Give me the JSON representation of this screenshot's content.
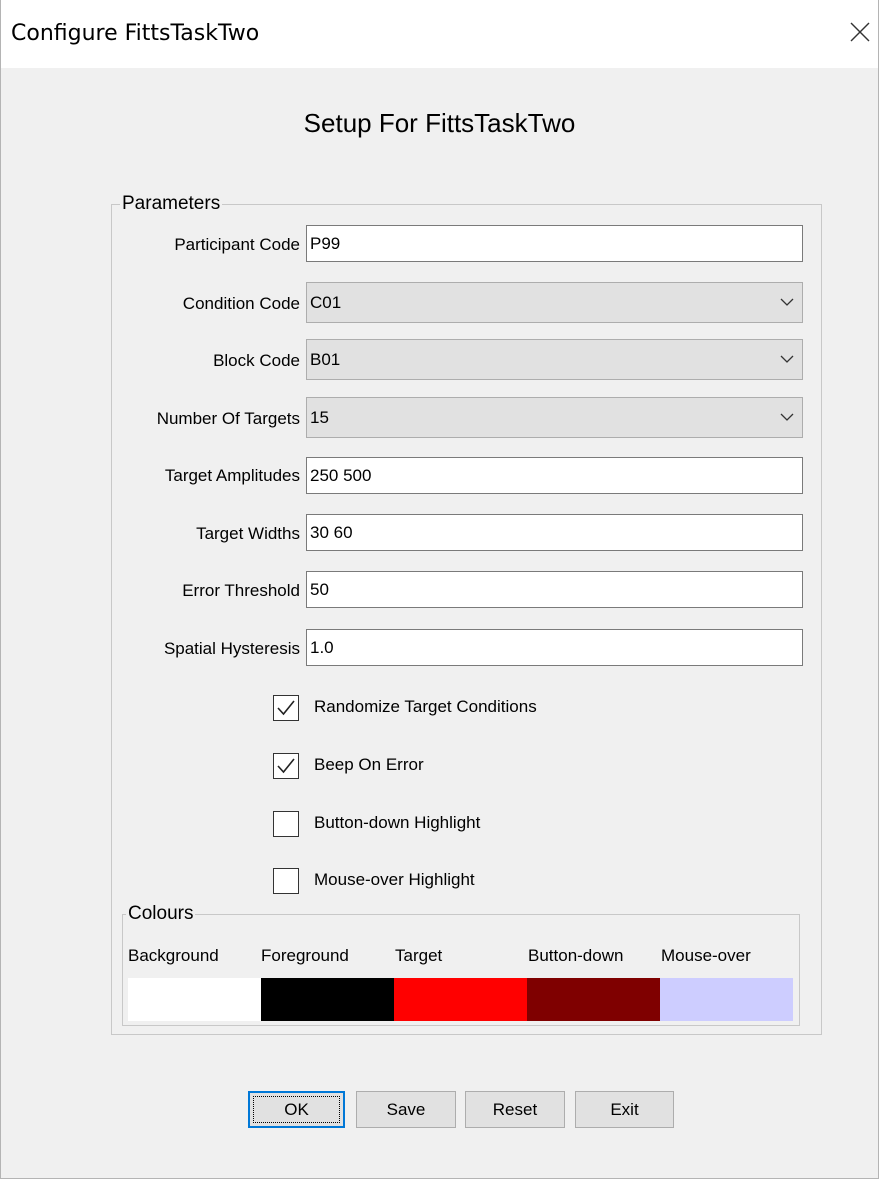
{
  "window": {
    "title": "Configure FittsTaskTwo"
  },
  "heading": "Setup For FittsTaskTwo",
  "parameters": {
    "legend": "Parameters",
    "participant_code": {
      "label": "Participant Code",
      "value": "P99"
    },
    "condition_code": {
      "label": "Condition Code",
      "value": "C01"
    },
    "block_code": {
      "label": "Block Code",
      "value": "B01"
    },
    "number_of_targets": {
      "label": "Number Of Targets",
      "value": "15"
    },
    "target_amplitudes": {
      "label": "Target Amplitudes",
      "value": "250 500"
    },
    "target_widths": {
      "label": "Target Widths",
      "value": "30 60"
    },
    "error_threshold": {
      "label": "Error Threshold",
      "value": "50"
    },
    "spatial_hysteresis": {
      "label": "Spatial Hysteresis",
      "value": "1.0"
    },
    "checkboxes": [
      {
        "label": "Randomize Target Conditions",
        "checked": true
      },
      {
        "label": "Beep On Error",
        "checked": true
      },
      {
        "label": "Button-down Highlight",
        "checked": false
      },
      {
        "label": "Mouse-over Highlight",
        "checked": false
      }
    ]
  },
  "colours": {
    "legend": "Colours",
    "swatches": [
      {
        "label": "Background",
        "color": "#ffffff"
      },
      {
        "label": "Foreground",
        "color": "#000000"
      },
      {
        "label": "Target",
        "color": "#ff0000"
      },
      {
        "label": "Button-down",
        "color": "#7f0000"
      },
      {
        "label": "Mouse-over",
        "color": "#cdcdff"
      }
    ]
  },
  "buttons": {
    "ok": "OK",
    "save": "Save",
    "reset": "Reset",
    "exit": "Exit"
  },
  "icons": {
    "close": "close-icon",
    "combo_arrow": "chevron-down-icon",
    "check": "checkmark-icon"
  }
}
